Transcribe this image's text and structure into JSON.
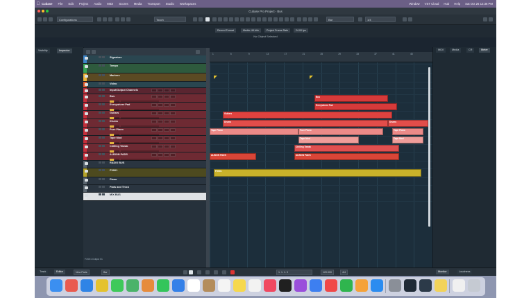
{
  "menubar": {
    "app_name": "Cubase",
    "items": [
      "File",
      "Edit",
      "Project",
      "Audio",
      "MIDI",
      "Scores",
      "Media",
      "Transport",
      "Studio",
      "Workspaces"
    ],
    "right_items": [
      "Window",
      "VST Cloud",
      "Hub",
      "Help"
    ],
    "clock": "Sat Oct 26 12:36 PM"
  },
  "window": {
    "title": "Cubase Pro Project - Bus"
  },
  "toolbar": {
    "configurations": "Configurations",
    "touch": "Touch",
    "grid": "Bar",
    "quantize": "1/4"
  },
  "info_tabs": [
    "Record Format",
    "Media: 48 kHz",
    "Project Frame Rate",
    "24.00 fps"
  ],
  "status": "No Object Selected",
  "left_tabs": {
    "visibility": "Visibility",
    "inspector": "Inspector"
  },
  "track_list": {
    "rows": [
      {
        "name": "Signature",
        "color": "#3e86c9",
        "kind": "system"
      },
      {
        "name": "Tempo",
        "color": "#38a456",
        "kind": "system"
      },
      {
        "name": "Markers",
        "color": "#f0b63a",
        "kind": "system"
      },
      {
        "name": "Video",
        "color": "#e05a2b",
        "kind": "system"
      },
      {
        "name": "Input/Output Channels",
        "color": "#c62e3a",
        "kind": "folder"
      },
      {
        "name": "Bus",
        "color": "#c62e3a",
        "kind": "group"
      },
      {
        "name": "Everywhere Pad",
        "color": "#c62e3a",
        "kind": "group"
      },
      {
        "name": "Guitars",
        "color": "#c62e3a",
        "kind": "group"
      },
      {
        "name": "Drums",
        "color": "#c62e3a",
        "kind": "group"
      },
      {
        "name": "Pure Piano",
        "color": "#c62e3a",
        "kind": "group"
      },
      {
        "name": "Tape Mod",
        "color": "#c62e3a",
        "kind": "group"
      },
      {
        "name": "Chilling Tweak",
        "color": "#c62e3a",
        "kind": "group"
      },
      {
        "name": "ALBION PADS",
        "color": "#c62e3a",
        "kind": "group"
      },
      {
        "name": "RADIO BUS",
        "color": "#5a6670",
        "kind": "plain"
      },
      {
        "name": "FX001",
        "color": "#b7a52a",
        "kind": "fx"
      },
      {
        "name": "Piano",
        "color": "#5a6670",
        "kind": "plain"
      },
      {
        "name": "Pads and Thick",
        "color": "#5a6670",
        "kind": "plain"
      },
      {
        "name": "MIX BUS",
        "color": "#e4e6e8",
        "kind": "selected"
      }
    ],
    "footer": "FX001 Output 01"
  },
  "ruler": {
    "bars": [
      "1",
      "5",
      "9",
      "13",
      "17",
      "21",
      "25",
      "29",
      "33",
      "37",
      "41",
      "45"
    ]
  },
  "arrange": {
    "clips": [
      {
        "label": "Bus",
        "track": 5,
        "start": 0.47,
        "end": 0.8
      },
      {
        "label": "Everywhere Pad",
        "track": 6,
        "start": 0.47,
        "end": 0.84
      },
      {
        "label": "Guitars",
        "track": 7,
        "start": 0.06,
        "end": 0.82
      },
      {
        "label": "Drums",
        "track": 8,
        "start": 0.06,
        "end": 0.8
      },
      {
        "label": "Drums",
        "track": 8,
        "start": 0.8,
        "end": 0.98
      },
      {
        "label": "Tape Piano",
        "track": 9,
        "start": 0.0,
        "end": 0.4
      },
      {
        "label": "Pure Piano",
        "track": 9,
        "start": 0.4,
        "end": 0.78
      },
      {
        "label": "Tape Piano",
        "track": 9,
        "start": 0.82,
        "end": 0.96
      },
      {
        "label": "Tape Mod",
        "track": 10,
        "start": 0.4,
        "end": 0.67
      },
      {
        "label": "Tape Mod",
        "track": 10,
        "start": 0.82,
        "end": 0.96
      },
      {
        "label": "Chilling Tweak",
        "track": 11,
        "start": 0.38,
        "end": 0.85
      },
      {
        "label": "ALBION PADS",
        "track": 12,
        "start": 0.0,
        "end": 0.21
      },
      {
        "label": "ALBION PADS",
        "track": 12,
        "start": 0.38,
        "end": 0.85
      },
      {
        "label": "FX001",
        "track": 14,
        "start": 0.02,
        "end": 0.95
      }
    ],
    "markers_at": [
      0.02,
      0.45
    ]
  },
  "right_tabs": [
    "MIDI",
    "Media",
    "CR",
    "Meter"
  ],
  "bottom_tabs": {
    "left": [
      "Track",
      "Editor"
    ],
    "right": [
      "Monitor",
      "Loudness"
    ]
  },
  "transport": {
    "new_parts": "New Parts",
    "bars": "Bar",
    "position": "1. 1. 1. 0",
    "tempo": "120.000",
    "signature": "4/4"
  },
  "dock": {
    "apps": [
      {
        "name": "finder",
        "color": "#3b8ff0"
      },
      {
        "name": "launchpad",
        "color": "#e95b4f"
      },
      {
        "name": "safari",
        "color": "#2f84e6"
      },
      {
        "name": "chrome",
        "color": "#e4c22f"
      },
      {
        "name": "messages",
        "color": "#3ec95a"
      },
      {
        "name": "maps",
        "color": "#4bb36a"
      },
      {
        "name": "photos",
        "color": "#e68b3c"
      },
      {
        "name": "facetime",
        "color": "#33c55b"
      },
      {
        "name": "mail",
        "color": "#3480e8"
      },
      {
        "name": "calendar",
        "color": "#ffffff"
      },
      {
        "name": "contacts",
        "color": "#b48d5c"
      },
      {
        "name": "reminders",
        "color": "#f4f4f4"
      },
      {
        "name": "notes",
        "color": "#f6d84e"
      },
      {
        "name": "freeform",
        "color": "#f2f2f2"
      },
      {
        "name": "music",
        "color": "#f04861"
      },
      {
        "name": "tv",
        "color": "#202020"
      },
      {
        "name": "podcasts",
        "color": "#9a4fdb"
      },
      {
        "name": "keynote",
        "color": "#3d7ff0"
      },
      {
        "name": "news",
        "color": "#f04848"
      },
      {
        "name": "numbers",
        "color": "#2fb54e"
      },
      {
        "name": "pages",
        "color": "#f5a23a"
      },
      {
        "name": "app-store",
        "color": "#2b8cf0"
      },
      {
        "name": "system-settings",
        "color": "#8a8f98"
      },
      {
        "name": "cubase",
        "color": "#1f2a36"
      },
      {
        "name": "steinberg-hub",
        "color": "#2c3a49"
      },
      {
        "name": "notes-folder",
        "color": "#f2d35a"
      },
      {
        "name": "preview",
        "color": "#f0f0f0"
      },
      {
        "name": "trash",
        "color": "#c5cad2"
      }
    ]
  }
}
